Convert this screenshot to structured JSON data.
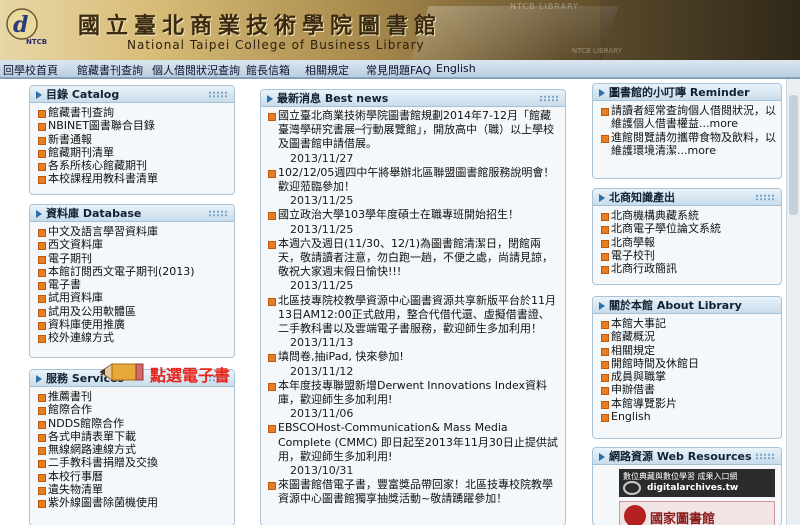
{
  "banner": {
    "logo_text": "NTCB",
    "title_zh": "國立臺北商業技術學院圖書館",
    "title_en": "National Taipei College of Business Library",
    "watermark_top": "NTCB LIBRARY",
    "watermark_bottom": "NTCB LIBRARY"
  },
  "navbar": {
    "items": [
      "回學校首頁",
      "館藏書刊查詢",
      "個人借閱狀況查詢",
      "館長信箱",
      "相關規定",
      "常見問題FAQ",
      "English"
    ]
  },
  "catalog": {
    "title": "目錄 Catalog",
    "items": [
      "館藏書刊查詢",
      "NBINET圖書聯合目錄",
      "新書通報",
      "館藏期刊清單",
      "各系所核心館藏期刊",
      "本校課程用教科書清單"
    ]
  },
  "databases": {
    "title": "資料庫 Database",
    "items": [
      "中文及語言學習資料庫",
      "西文資料庫",
      "電子期刊",
      "本館訂閱西文電子期刊(2013)",
      "電子書",
      "試用資料庫",
      "試用及公用軟體區",
      "資料庫使用推廣",
      "校外連線方式"
    ]
  },
  "callout": {
    "text": "點選電子書"
  },
  "services": {
    "title": "服務 Services",
    "items": [
      "推薦書刊",
      "館際合作",
      "NDDS館際合作",
      "各式申請表單下載",
      "無線網路連線方式",
      "二手教科書捐贈及交換",
      "本校行事曆",
      "遺失物清單",
      "紫外線圖書除菌機使用"
    ]
  },
  "news": {
    "title": "最新消息 Best news",
    "entries": [
      {
        "text": "國立臺北商業技術學院圖書館規劃2014年7-12月「館藏臺灣學研究書展─行動展覽館」，開放高中（職）以上學校及圖書館申請借展。",
        "date": "2013/11/27"
      },
      {
        "text": "102/12/05週四中午將舉辦北區聯盟圖書館服務說明會！歡迎蒞臨參加！",
        "date": "2013/11/25"
      },
      {
        "text": "國立政治大學103學年度碩士在職專班開始招生！",
        "date": "2013/11/25"
      },
      {
        "text": "本週六及週日(11/30、12/1)為圖書館清潔日，閉館兩天，敬請讀者注意，勿白跑一趟，不便之處，尚請見諒，敬祝大家週末假日愉快!!!",
        "date": "2013/11/25"
      },
      {
        "text": "北區技專院校教學資源中心圖書資源共享新版平台於11月13日AM12:00正式啟用，整合代借代還、虛擬借書證、二手教科書以及雲端電子書服務，歡迎師生多加利用！",
        "date": "2013/11/13"
      },
      {
        "text": "填問卷,抽iPad, 快來參加!",
        "date": "2013/11/12"
      },
      {
        "text": "本年度技專聯盟新增Derwent Innovations Index資料庫，歡迎師生多加利用!",
        "date": "2013/11/06"
      },
      {
        "text": "EBSCOHost-Communication& Mass Media Complete (CMMC) 即日起至2013年11月30日止提供試用，歡迎師生多加利用!",
        "date": "2013/10/31"
      },
      {
        "text": "來圖書館借電子書，豐富獎品帶回家！北區技專校院教學資源中心圖書館獨享抽獎活動~敬請踴躍參加！",
        "date": ""
      }
    ]
  },
  "reminder": {
    "title": "圖書館的小叮嚀 Reminder",
    "items": [
      "請讀者經常查詢個人借閱狀況，以維護個人借書權益...more",
      "進館閱覽請勿攜帶食物及飲料，以維護環境清潔...more"
    ]
  },
  "knowledge": {
    "title": "北商知識產出",
    "items": [
      "北商機構典藏系統",
      "北商電子學位論文系統",
      "北商學報",
      "電子校刊",
      "北商行政簡訊"
    ]
  },
  "about": {
    "title": "關於本館 About Library",
    "items": [
      "本館大事記",
      "館藏概況",
      "相關規定",
      "開館時間及休館日",
      "成員與職掌",
      "申辦借書",
      "本館導覽影片",
      "English"
    ]
  },
  "web": {
    "title": "網路資源 Web Resources",
    "thumb1_top": "數位典藏與數位學習 成果入口網",
    "thumb1_url": "digitalarchives.tw",
    "thumb2_text": "國家圖書館"
  },
  "colors": {
    "accent": "#e67e22",
    "panel_border": "#aac3d6",
    "callout": "#e8261c"
  }
}
